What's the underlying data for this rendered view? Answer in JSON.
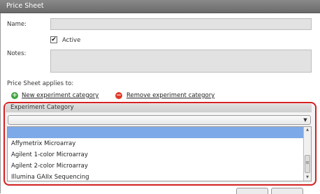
{
  "window": {
    "title": "Price Sheet"
  },
  "form": {
    "name_label": "Name:",
    "name_value": "",
    "active_label": "Active",
    "active_checked": true,
    "active_mark": "✔",
    "notes_label": "Notes:",
    "notes_value": "",
    "applies_label": "Price Sheet applies to:",
    "new_category_link": "New experiment category",
    "remove_category_link": "Remove experiment category",
    "add_icon_glyph": "+",
    "remove_icon_glyph": "−"
  },
  "category": {
    "header": "Experiment Category",
    "selected_value": "",
    "dropdown_arrow": "▼",
    "options": [
      "",
      "Affymetrix Microarray",
      "Agilent 1-color Microarray",
      "Agilent 2-color Microarray",
      "Illumina GAIIx Sequencing"
    ],
    "scroll_up": "▲",
    "scroll_down": "▼",
    "scroll_grip": "≡"
  },
  "colors": {
    "highlight_border": "#d42020",
    "selected_item": "#7ea9e8",
    "add_icon": "#3da43d",
    "remove_icon": "#e03a2a"
  }
}
